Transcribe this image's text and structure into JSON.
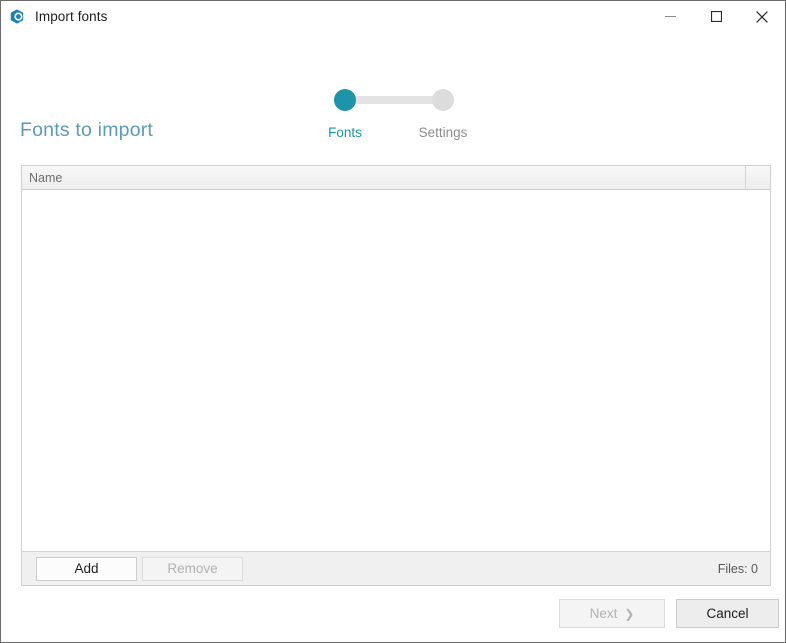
{
  "window": {
    "title": "Import fonts",
    "app_icon": "app-logo-icon",
    "border_color": "#6b6b6b",
    "background": "#ffffff",
    "controls": [
      {
        "name": "minimize-button",
        "icon": "minimize-icon",
        "label": "Minimize"
      },
      {
        "name": "maximize-button",
        "icon": "maximize-icon",
        "label": "Maximize"
      },
      {
        "name": "close-button",
        "icon": "close-icon",
        "label": "Close"
      }
    ]
  },
  "stepper": {
    "active_color": "#1f93a7",
    "inactive_color": "#dcdcdc",
    "track_color": "#e3e3e3",
    "active_index": 0,
    "steps": [
      {
        "label": "Fonts",
        "state": "active"
      },
      {
        "label": "Settings",
        "state": "inactive"
      }
    ]
  },
  "main": {
    "heading": "Fonts to import",
    "heading_color": "#5a9cb8",
    "list": {
      "columns": [
        "Name"
      ],
      "rows": [],
      "empty": true
    },
    "toolbar": {
      "add_label": "Add",
      "add_enabled": true,
      "remove_label": "Remove",
      "remove_enabled": false,
      "files_status": "Files: 0"
    }
  },
  "footer": {
    "next_label": "Next",
    "next_chevron": "❯",
    "next_enabled": false,
    "cancel_label": "Cancel",
    "cancel_enabled": true
  }
}
